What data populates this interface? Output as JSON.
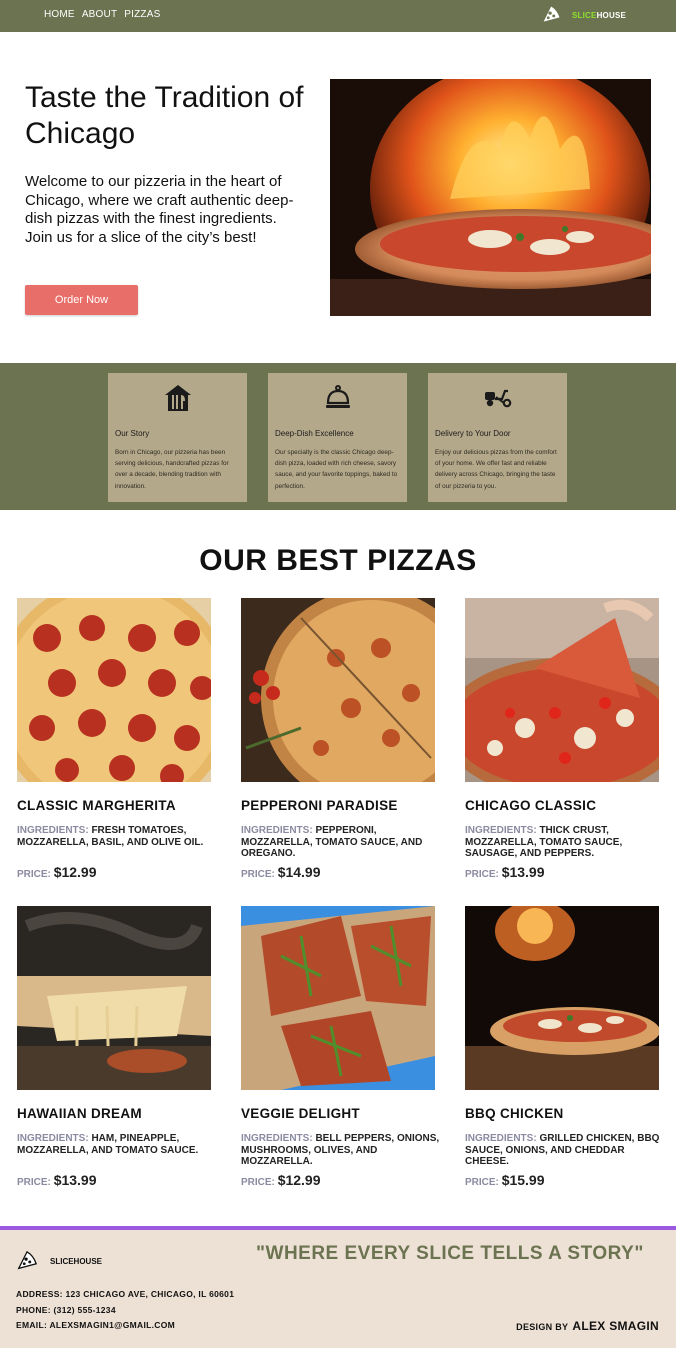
{
  "header": {
    "nav": [
      "HOME",
      "ABOUT",
      "PIZZAS"
    ],
    "brand": {
      "part1": "SLICE",
      "part2": "HOUSE"
    },
    "colors": {
      "bar": "#6b7350",
      "brand_accent": "#8ee22d"
    }
  },
  "hero": {
    "title": "Taste the Tradition of Chicago",
    "description": "Welcome to our pizzeria in the heart of Chicago, where we craft authentic deep-dish pizzas with the finest ingredients. Join us for a slice of the city’s best!",
    "button": "Order Now",
    "button_color": "#e86e69",
    "image": "wood-fired-pizza-oven-photo"
  },
  "features": [
    {
      "icon": "restaurant-icon",
      "title": "Our Story",
      "text": "Born in Chicago, our pizzeria has been serving delicious, handcrafted pizzas for over a decade, blending tradition with innovation."
    },
    {
      "icon": "cloche-icon",
      "title": "Deep-Dish Excellence",
      "text": "Our specialty is the classic Chicago deep-dish pizza, loaded with rich cheese, savory sauce, and your favorite toppings, baked to perfection."
    },
    {
      "icon": "scooter-icon",
      "title": "Delivery to Your Door",
      "text": "Enjoy our delicious pizzas from the comfort of your home. We offer fast and reliable delivery across Chicago, bringing the taste of our pizzeria to you."
    }
  ],
  "best": {
    "title": "OUR BEST PIZZAS",
    "ingredients_label": "INGREDIENTS:",
    "price_label": "PRICE:",
    "items": [
      {
        "name": "CLASSIC MARGHERITA",
        "ingredients": "FRESH TOMATOES, MOZZARELLA, BASIL, AND OLIVE OIL.",
        "price": "$12.99"
      },
      {
        "name": "PEPPERONI PARADISE",
        "ingredients": "PEPPERONI, MOZZARELLA, TOMATO SAUCE, AND OREGANO.",
        "price": "$14.99"
      },
      {
        "name": "CHICAGO CLASSIC",
        "ingredients": "THICK CRUST, MOZZARELLA, TOMATO SAUCE, SAUSAGE, AND PEPPERS.",
        "price": "$13.99"
      },
      {
        "name": "HAWAIIAN DREAM",
        "ingredients": "HAM, PINEAPPLE, MOZZARELLA, AND TOMATO SAUCE.",
        "price": "$13.99"
      },
      {
        "name": "VEGGIE DELIGHT",
        "ingredients": "BELL PEPPERS, ONIONS, MUSHROOMS, OLIVES, AND MOZZARELLA.",
        "price": "$12.99"
      },
      {
        "name": "BBQ CHICKEN",
        "ingredients": "GRILLED CHICKEN, BBQ SAUCE, ONIONS, AND CHEDDAR CHEESE.",
        "price": "$15.99"
      }
    ]
  },
  "footer": {
    "brand": "SLICEHOUSE",
    "quote": "\"WHERE EVERY SLICE TELLS A STORY\"",
    "address_label": "ADDRESS:",
    "address": "123 CHICAGO AVE, CHICAGO, IL 60601",
    "phone_label": "PHONE:",
    "phone": "(312) 555-1234",
    "email_label": "EMAIL:",
    "email": "ALEXSMAGIN1@GMAIL.COM",
    "design_label": "DESIGN BY",
    "designer": "ALEX SMAGIN",
    "accent_line": "#9b59e0"
  }
}
